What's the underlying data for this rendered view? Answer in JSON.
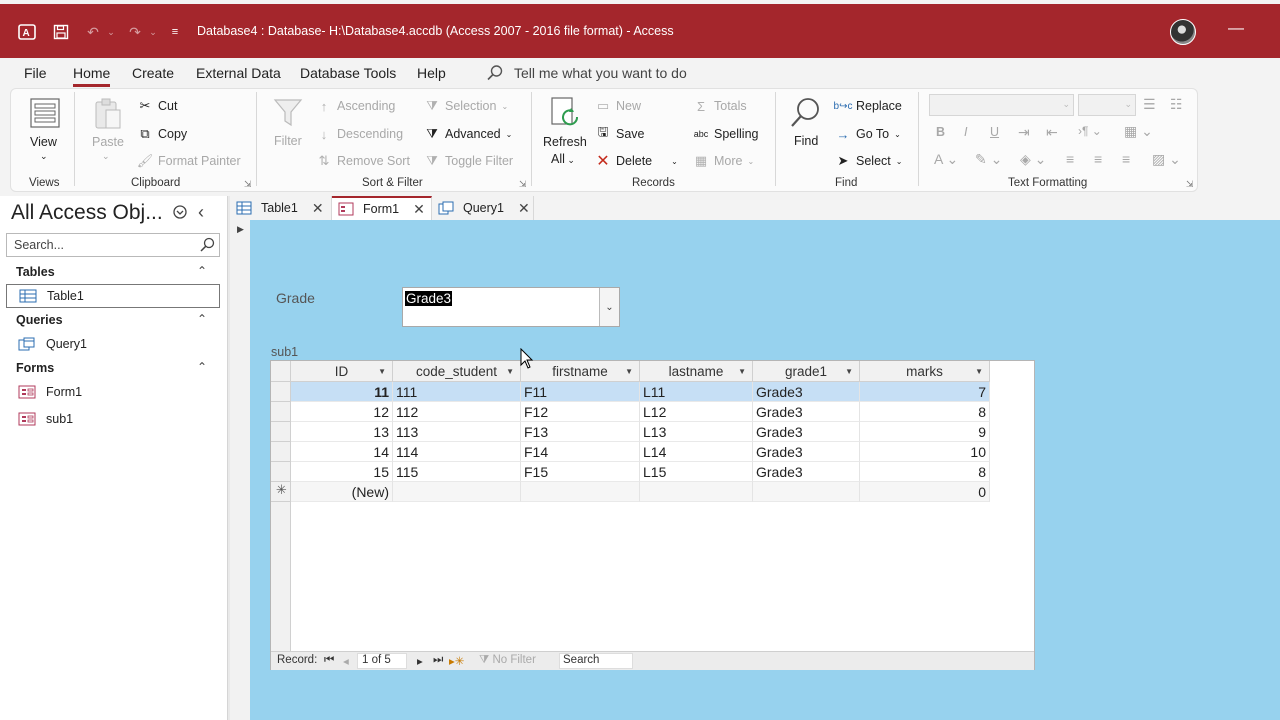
{
  "titlebar": {
    "title": "Database4 : Database- H:\\Database4.accdb (Access 2007 - 2016 file format)  -  Access",
    "minimize": "—"
  },
  "menu": {
    "items": [
      "File",
      "Home",
      "Create",
      "External Data",
      "Database Tools",
      "Help"
    ],
    "active": "Home",
    "tell_me": "Tell me what you want to do"
  },
  "ribbon": {
    "views": {
      "view": "View",
      "label": "Views"
    },
    "clipboard": {
      "paste": "Paste",
      "cut": "Cut",
      "copy": "Copy",
      "format_painter": "Format Painter",
      "label": "Clipboard"
    },
    "sort_filter": {
      "filter": "Filter",
      "ascending": "Ascending",
      "descending": "Descending",
      "remove_sort": "Remove Sort",
      "selection": "Selection",
      "advanced": "Advanced",
      "toggle_filter": "Toggle Filter",
      "label": "Sort & Filter"
    },
    "records": {
      "refresh": "Refresh",
      "refresh_all": "All",
      "new": "New",
      "save": "Save",
      "delete": "Delete",
      "totals": "Totals",
      "spelling": "Spelling",
      "more": "More",
      "label": "Records"
    },
    "find": {
      "find": "Find",
      "replace": "Replace",
      "goto": "Go To",
      "select": "Select",
      "label": "Find"
    },
    "text_formatting": {
      "bold": "B",
      "italic": "I",
      "underline": "U",
      "label": "Text Formatting"
    }
  },
  "nav": {
    "title": "All Access Obj...",
    "search_placeholder": "Search...",
    "groups": [
      {
        "header": "Tables",
        "items": [
          "Table1"
        ]
      },
      {
        "header": "Queries",
        "items": [
          "Query1"
        ]
      },
      {
        "header": "Forms",
        "items": [
          "Form1",
          "sub1"
        ]
      }
    ]
  },
  "doctabs": [
    {
      "label": "Table1",
      "icon": "table-icon"
    },
    {
      "label": "Form1",
      "icon": "form-icon"
    },
    {
      "label": "Query1",
      "icon": "query-icon"
    }
  ],
  "form": {
    "grade_label": "Grade",
    "grade_value": "Grade3",
    "subform_label": "sub1"
  },
  "datasheet": {
    "columns": [
      "ID",
      "code_student",
      "firstname",
      "lastname",
      "grade1",
      "marks"
    ],
    "rows": [
      [
        "11",
        "111",
        "F11",
        "L11",
        "Grade3",
        "7"
      ],
      [
        "12",
        "112",
        "F12",
        "L12",
        "Grade3",
        "8"
      ],
      [
        "13",
        "113",
        "F13",
        "L13",
        "Grade3",
        "9"
      ],
      [
        "14",
        "114",
        "F14",
        "L14",
        "Grade3",
        "10"
      ],
      [
        "15",
        "115",
        "F15",
        "L15",
        "Grade3",
        "8"
      ]
    ],
    "new_row": {
      "id": "(New)",
      "marks": "0"
    },
    "record_nav": {
      "label": "Record:",
      "position": "1 of 5",
      "no_filter": "No Filter",
      "search": "Search"
    }
  },
  "colors": {
    "accent": "#a4262c",
    "form_bg": "#97d2ee",
    "selected_row": "#c6dff5"
  }
}
